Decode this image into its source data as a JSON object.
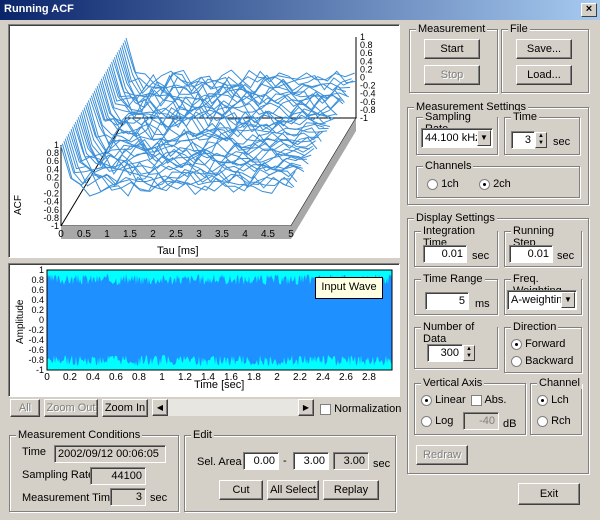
{
  "window": {
    "title": "Running ACF",
    "close": "×"
  },
  "acf_chart": {
    "ylabel": "ACF",
    "xlabel": "Tau [ms]",
    "x_ticks": [
      "0",
      "0.5",
      "1",
      "1.5",
      "2",
      "2.5",
      "3",
      "3.5",
      "4",
      "4.5",
      "5"
    ],
    "y_ticks": [
      "1",
      "0.8",
      "0.6",
      "0.4",
      "0.2",
      "0",
      "-0.2",
      "-0.4",
      "-0.6",
      "-0.8",
      "-1"
    ],
    "color": "#3a8fd8"
  },
  "wave_chart": {
    "ylabel": "Amplitude",
    "xlabel": "Time [sec]",
    "legend": "Input Wave",
    "x_ticks": [
      "0",
      "0.2",
      "0.4",
      "0.6",
      "0.8",
      "1",
      "1.2",
      "1.4",
      "1.6",
      "1.8",
      "2",
      "2.2",
      "2.4",
      "2.6",
      "2.8"
    ],
    "y_ticks": [
      "1",
      "0.8",
      "0.6",
      "0.4",
      "0.2",
      "0",
      "-0.2",
      "-0.4",
      "-0.6",
      "-0.8",
      "-1"
    ],
    "fill_color": "#1e90ff",
    "bg_color": "#00ffff"
  },
  "nav": {
    "all": "All",
    "zoom_out": "Zoom Out",
    "zoom_in": "Zoom In",
    "normalization": "Normalization"
  },
  "measurement_conditions": {
    "label": "Measurement Conditions",
    "time_label": "Time",
    "time_value": "2002/09/12 00:06:05",
    "rate_label": "Sampling Rate",
    "rate_value": "44100",
    "mtime_label": "Measurement Time",
    "mtime_value": "3",
    "mtime_unit": "sec"
  },
  "edit": {
    "label": "Edit",
    "sel_area_label": "Sel. Area",
    "from": "0.00",
    "dash": "-",
    "to": "3.00",
    "length": "3.00",
    "unit": "sec",
    "cut": "Cut",
    "all_select": "All Select",
    "replay": "Replay"
  },
  "measurement": {
    "label": "Measurement",
    "start": "Start",
    "stop": "Stop"
  },
  "file": {
    "label": "File",
    "save": "Save...",
    "load": "Load..."
  },
  "measurement_settings": {
    "label": "Measurement Settings",
    "sampling_rate_label": "Sampling Rate",
    "sampling_rate_value": "44.100 kHz",
    "time_label": "Time",
    "time_value": "3",
    "time_unit": "sec",
    "channels_label": "Channels",
    "ch1": "1ch",
    "ch2": "2ch"
  },
  "display_settings": {
    "label": "Display Settings",
    "integration_label": "Integration Time",
    "integration_value": "0.01",
    "integration_unit": "sec",
    "running_step_label": "Running Step",
    "running_step_value": "0.01",
    "running_step_unit": "sec",
    "time_range_label": "Time Range",
    "time_range_value": "5",
    "time_range_unit": "ms",
    "freq_weighting_label": "Freq. Weighting",
    "freq_weighting_value": "A-weighting",
    "num_data_label": "Number of Data",
    "num_data_value": "300",
    "direction_label": "Direction",
    "forward": "Forward",
    "backward": "Backward",
    "vertical_axis_label": "Vertical Axis",
    "linear": "Linear",
    "abs": "Abs.",
    "log": "Log",
    "log_value": "-40",
    "log_unit": "dB",
    "channel_label": "Channel",
    "lch": "Lch",
    "rch": "Rch",
    "redraw": "Redraw"
  },
  "exit": "Exit"
}
